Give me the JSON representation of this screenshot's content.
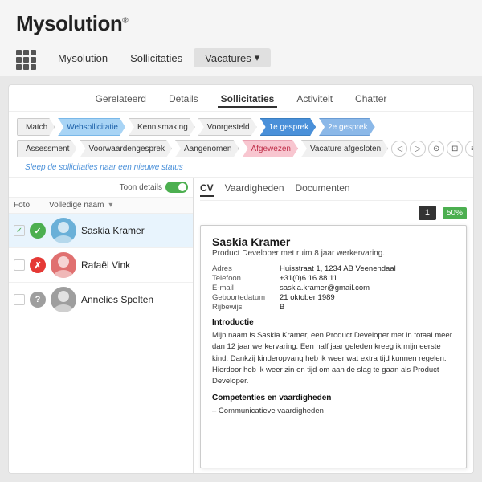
{
  "header": {
    "logo": "Mysolution",
    "logo_sup": "®",
    "nav": [
      {
        "label": "Mysolution",
        "active": false
      },
      {
        "label": "Sollicitaties",
        "active": false
      },
      {
        "label": "Vacatures",
        "active": true,
        "dropdown": true
      }
    ]
  },
  "tabs": [
    {
      "label": "Gerelateerd",
      "active": false
    },
    {
      "label": "Details",
      "active": false
    },
    {
      "label": "Sollicitaties",
      "active": true
    },
    {
      "label": "Activiteit",
      "active": false
    },
    {
      "label": "Chatter",
      "active": false
    }
  ],
  "pipeline": {
    "row1": [
      {
        "label": "Match",
        "style": "normal"
      },
      {
        "label": "Websollicitatie",
        "style": "active"
      },
      {
        "label": "Kennismaking",
        "style": "normal"
      },
      {
        "label": "Voorgesteld",
        "style": "normal"
      },
      {
        "label": "1e gesprek",
        "style": "dark"
      },
      {
        "label": "2e gesprek",
        "style": "medium"
      }
    ],
    "row2": [
      {
        "label": "Assessment",
        "style": "normal"
      },
      {
        "label": "Voorwaardengesprek",
        "style": "normal"
      },
      {
        "label": "Aangenomen",
        "style": "normal"
      },
      {
        "label": "Afgewezen",
        "style": "highlighted"
      },
      {
        "label": "Vacature afgesloten",
        "style": "normal"
      }
    ],
    "drag_hint": "Sleep de sollicitaties naar een nieuwe status"
  },
  "list": {
    "toon_details_label": "Toon details",
    "columns": {
      "foto": "Foto",
      "naam": "Volledige naam"
    },
    "candidates": [
      {
        "name": "Saskia Kramer",
        "status": "check",
        "status_color": "#4caf50",
        "status_symbol": "✓",
        "selected": true
      },
      {
        "name": "Rafaël Vink",
        "status": "cross",
        "status_color": "#e53935",
        "status_symbol": "✗",
        "selected": false
      },
      {
        "name": "Annelies Spelten",
        "status": "question",
        "status_color": "#9e9e9e",
        "status_symbol": "?",
        "selected": false
      }
    ]
  },
  "detail": {
    "tabs": [
      {
        "label": "CV",
        "active": true
      },
      {
        "label": "Vaardigheden",
        "active": false
      },
      {
        "label": "Documenten",
        "active": false
      }
    ],
    "page_num": "1",
    "zoom": "50%",
    "action_icons": [
      "◁",
      "▷",
      "⊙",
      "⊡",
      "≡"
    ],
    "cv": {
      "name": "Saskia Kramer",
      "title": "Product Developer met ruim 8 jaar werkervaring.",
      "info": [
        {
          "label": "Adres",
          "value": "Huisstraat 1, 1234 AB Veenendaal"
        },
        {
          "label": "Telefoon",
          "value": "+31(0)6 16 88 11"
        },
        {
          "label": "E-mail",
          "value": "saskia.kramer@gmail.com"
        },
        {
          "label": "Geboortedatum",
          "value": "21 oktober 1989"
        },
        {
          "label": "Rijbewijs",
          "value": "B"
        }
      ],
      "sections": [
        {
          "title": "Introductie",
          "text": "Mijn naam is Saskia Kramer, een Product Developer met in totaal meer dan 12 jaar werkervaring. Een half jaar geleden kreeg ik mijn eerste kind. Dankzij kinderopvang heb ik weer wat extra tijd kunnen regelen. Hierdoor heb ik weer zin en tijd om aan de slag te gaan als Product Developer."
        },
        {
          "title": "Competenties en vaardigheden",
          "text": "– Communicatieve vaardigheden"
        }
      ]
    }
  }
}
